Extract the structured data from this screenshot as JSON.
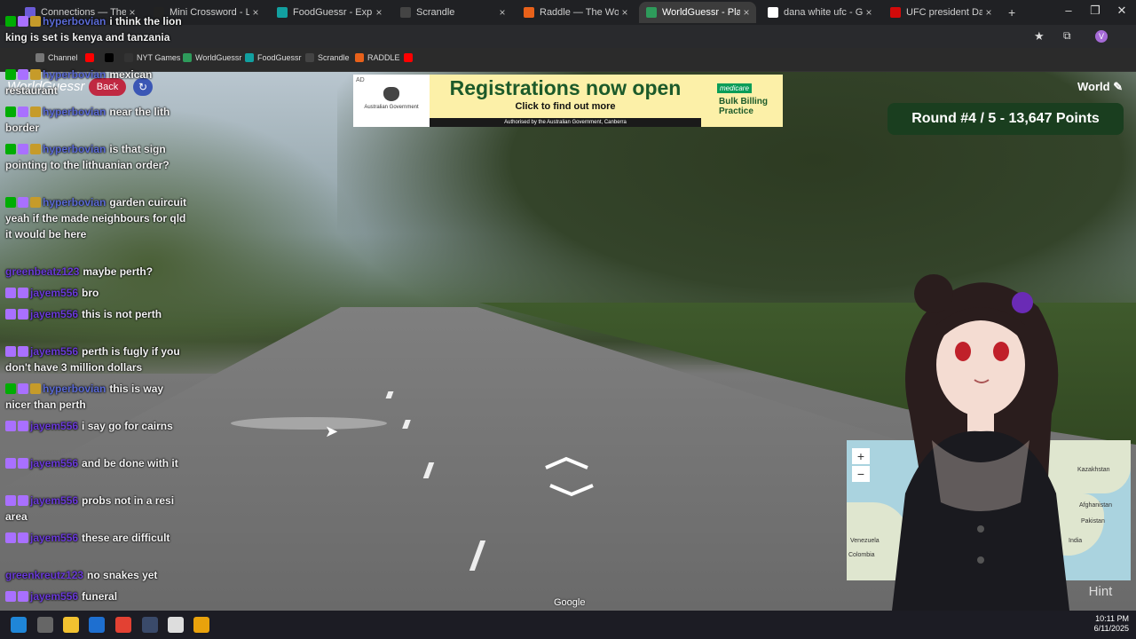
{
  "browser": {
    "tabs": [
      {
        "title": "Connections — The New",
        "active": false,
        "color": "#6b5bd6"
      },
      {
        "title": "Mini Crossword - Los Ang",
        "active": false,
        "color": "#222222"
      },
      {
        "title": "FoodGuessr - Explore the",
        "active": false,
        "color": "#12a0a0"
      },
      {
        "title": "Scrandle",
        "active": false,
        "color": "#444444"
      },
      {
        "title": "Raddle — The Word Trans",
        "active": false,
        "color": "#e8611a"
      },
      {
        "title": "WorldGuessr - Play Geog",
        "active": true,
        "color": "#2e9b5b"
      },
      {
        "title": "dana white ufc - Google S",
        "active": false,
        "color": "#ffffff"
      },
      {
        "title": "UFC president Dana Whi",
        "active": false,
        "color": "#d20a0a"
      }
    ],
    "new_tab": "+",
    "bookmarks": [
      {
        "label": "Channel",
        "color": "#777777"
      },
      {
        "label": "",
        "color": "#ff0000"
      },
      {
        "label": "",
        "color": "#000000"
      },
      {
        "label": "NYT Games",
        "color": "#333333"
      },
      {
        "label": "WorldGuessr",
        "color": "#2e9b5b"
      },
      {
        "label": "FoodGuessr",
        "color": "#12a0a0"
      },
      {
        "label": "Scrandle",
        "color": "#444444"
      },
      {
        "label": "RADDLE",
        "color": "#e8611a"
      },
      {
        "label": "",
        "color": "#ff0000"
      }
    ]
  },
  "ad": {
    "label": "AD",
    "sponsor": "Australian Government",
    "headline": "Registrations now open",
    "cta": "Click to find out more",
    "authorised": "Authorised by the Australian Government, Canberra",
    "medicare": "medicare",
    "offer": "Bulk Billing Practice"
  },
  "game": {
    "logo": "WorldGuessr",
    "back": "Back",
    "refresh_icon": "↻",
    "mode": "World",
    "round": "Round #4 / 5 - 13,647 Points",
    "hint": "Hint",
    "watermark": "Google",
    "zoom_in": "+",
    "zoom_out": "−"
  },
  "map_labels": [
    "Kazakhstan",
    "Afghanistan",
    "Pakistan",
    "India",
    "Venezuela",
    "Colombia"
  ],
  "chat": [
    {
      "user": "hyperbovian",
      "color": "#5b6bd6",
      "badges": [
        "mod",
        "sub",
        "gift"
      ],
      "text": "i think the lion king is set is kenya and tanzania"
    },
    {
      "user": "hyperbovian",
      "color": "#5b6bd6",
      "badges": [
        "mod",
        "sub",
        "gift"
      ],
      "text": "mexican restaurant"
    },
    {
      "user": "hyperbovian",
      "color": "#5b6bd6",
      "badges": [
        "mod",
        "sub",
        "gift"
      ],
      "text": "near the lith border"
    },
    {
      "user": "hyperbovian",
      "color": "#5b6bd6",
      "badges": [
        "mod",
        "sub",
        "gift"
      ],
      "text": "is that sign pointing to the lithuanian order?"
    },
    {
      "user": "hyperbovian",
      "color": "#5b6bd6",
      "badges": [
        "mod",
        "sub",
        "gift"
      ],
      "text": "garden cuircuit yeah if the made neighbours for qld it would be here"
    },
    {
      "user": "greenbeatz123",
      "color": "#6a3ad8",
      "badges": [],
      "text": "maybe perth?"
    },
    {
      "user": "jayem556",
      "color": "#6a3ad8",
      "badges": [
        "sub",
        "sub"
      ],
      "text": "bro"
    },
    {
      "user": "jayem556",
      "color": "#6a3ad8",
      "badges": [
        "sub",
        "sub"
      ],
      "text": "this is not perth"
    },
    {
      "user": "jayem556",
      "color": "#6a3ad8",
      "badges": [
        "sub",
        "sub"
      ],
      "text": "perth is fugly if you don't have 3 million dollars"
    },
    {
      "user": "hyperbovian",
      "color": "#5b6bd6",
      "badges": [
        "mod",
        "sub",
        "gift"
      ],
      "text": "this is way nicer than perth"
    },
    {
      "user": "jayem556",
      "color": "#6a3ad8",
      "badges": [
        "sub",
        "sub"
      ],
      "text": "i say go for cairns"
    },
    {
      "user": "jayem556",
      "color": "#6a3ad8",
      "badges": [
        "sub",
        "sub"
      ],
      "text": "and be done with it"
    },
    {
      "user": "jayem556",
      "color": "#6a3ad8",
      "badges": [
        "sub",
        "sub"
      ],
      "text": "probs not in a resi area"
    },
    {
      "user": "jayem556",
      "color": "#6a3ad8",
      "badges": [
        "sub",
        "sub"
      ],
      "text": "these are difficult"
    },
    {
      "user": "greenkreutz123",
      "color": "#6a3ad8",
      "badges": [],
      "text": "no snakes yet"
    },
    {
      "user": "jayem556",
      "color": "#6a3ad8",
      "badges": [
        "sub",
        "sub"
      ],
      "text": "funeral"
    }
  ],
  "clock": {
    "time": "10:11 PM",
    "date": "6/11/2025"
  }
}
